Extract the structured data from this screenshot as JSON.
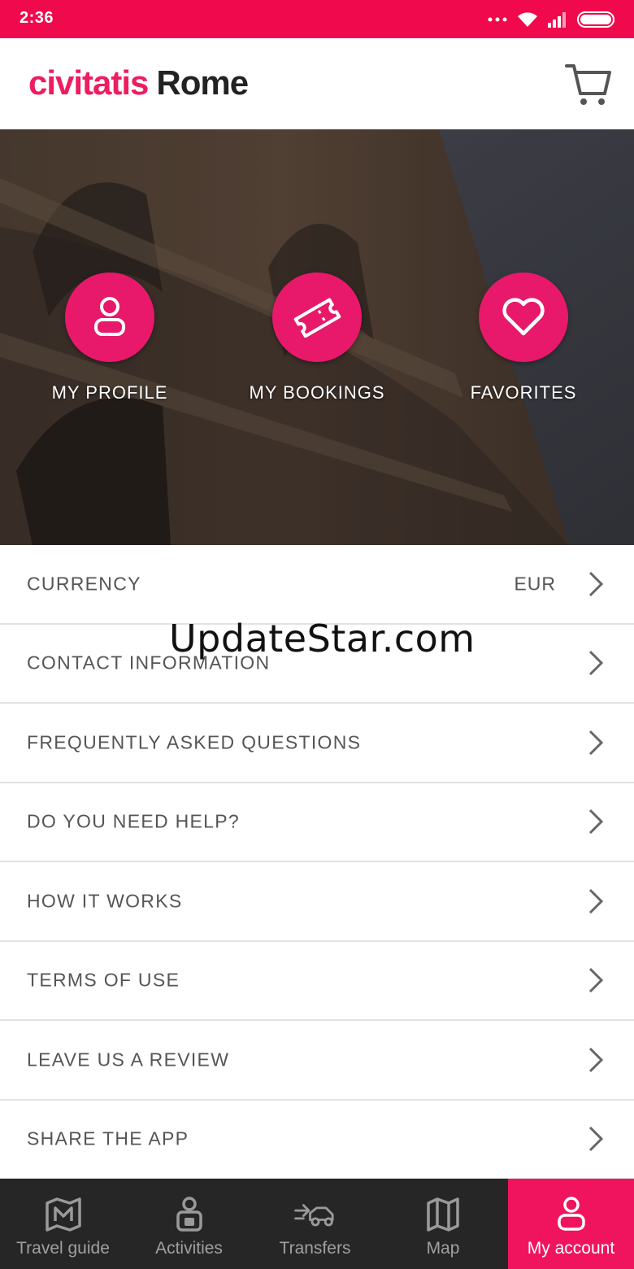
{
  "status_bar": {
    "time": "2:36"
  },
  "header": {
    "brand": "civitatis",
    "city": "Rome"
  },
  "shortcuts": [
    {
      "label": "MY PROFILE",
      "icon": "user-icon"
    },
    {
      "label": "MY BOOKINGS",
      "icon": "ticket-icon"
    },
    {
      "label": "FAVORITES",
      "icon": "heart-icon"
    }
  ],
  "menu": {
    "items": [
      {
        "label": "CURRENCY",
        "value": "EUR"
      },
      {
        "label": "CONTACT INFORMATION"
      },
      {
        "label": "FREQUENTLY ASKED QUESTIONS"
      },
      {
        "label": "DO YOU NEED HELP?"
      },
      {
        "label": "HOW IT WORKS"
      },
      {
        "label": "TERMS OF USE"
      },
      {
        "label": "LEAVE US A REVIEW"
      },
      {
        "label": "SHARE THE APP"
      }
    ]
  },
  "watermark": "UpdateStar.com",
  "bottom_nav": {
    "items": [
      {
        "label": "Travel guide",
        "icon": "map-guide-icon"
      },
      {
        "label": "Activities",
        "icon": "activities-icon"
      },
      {
        "label": "Transfers",
        "icon": "transfer-icon"
      },
      {
        "label": "Map",
        "icon": "map-icon"
      },
      {
        "label": "My account",
        "icon": "account-icon",
        "active": true
      }
    ]
  },
  "colors": {
    "brand": "#ee1d5f",
    "status_bar": "#f0094c",
    "nav_bg": "#262626",
    "active_tab": "#f0145f"
  }
}
